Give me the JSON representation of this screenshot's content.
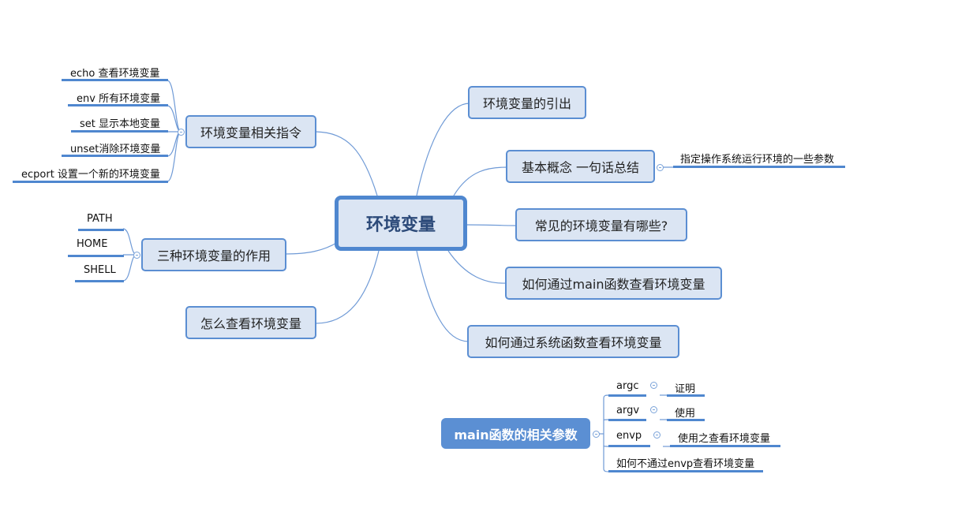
{
  "central": {
    "label": "环境变量"
  },
  "left_topics": [
    {
      "label": "环境变量相关指令",
      "children": [
        "echo 查看环境变量",
        "env 所有环境变量",
        "set 显示本地变量",
        "unset消除环境变量",
        "ecport 设置一个新的环境变量"
      ]
    },
    {
      "label": "三种环境变量的作用",
      "children": [
        "PATH",
        "HOME",
        "SHELL"
      ]
    },
    {
      "label": "怎么查看环境变量",
      "children": []
    }
  ],
  "right_topics": [
    {
      "label": "环境变量的引出",
      "children": []
    },
    {
      "label": "基本概念 一句话总结",
      "children": [
        "指定操作系统运行环境的一些参数"
      ]
    },
    {
      "label": "常见的环境变量有哪些?",
      "children": []
    },
    {
      "label": "如何通过main函数查看环境变量",
      "children": []
    },
    {
      "label": "如何通过系统函数查看环境变量",
      "children": []
    }
  ],
  "floating_topic": {
    "label": "main函数的相关参数",
    "children": [
      {
        "label": "argc",
        "child": "证明"
      },
      {
        "label": "argv",
        "child": "使用"
      },
      {
        "label": "envp",
        "child": "使用之查看环境变量"
      },
      {
        "label": "如何不通过envp查看环境变量",
        "child": null
      }
    ]
  },
  "colors": {
    "line": "#5b8ed2",
    "node_fill": "#dbe5f3",
    "accent": "#4f87cf",
    "central_text": "#2c4a79"
  }
}
